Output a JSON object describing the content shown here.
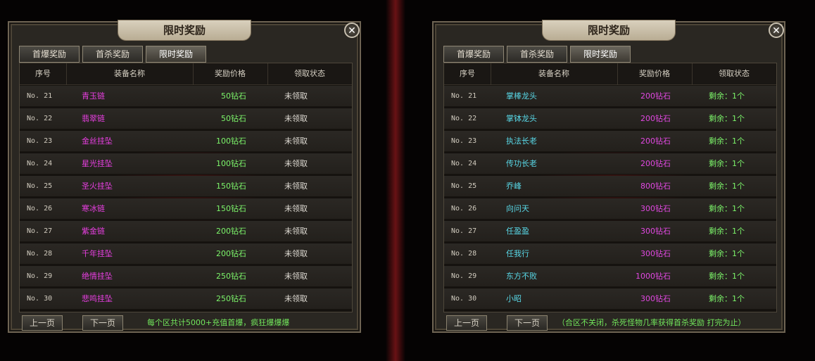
{
  "left_panel": {
    "title": "限时奖励",
    "tabs": [
      "首爆奖励",
      "首杀奖励",
      "限时奖励"
    ],
    "active_tab": 2,
    "columns": [
      "序号",
      "装备名称",
      "奖励价格",
      "领取状态"
    ],
    "rows": [
      {
        "no": "No. 21",
        "name": "青玉链",
        "price": "50钻石",
        "status": "未领取"
      },
      {
        "no": "No. 22",
        "name": "翡翠链",
        "price": "50钻石",
        "status": "未领取"
      },
      {
        "no": "No. 23",
        "name": "金丝挂坠",
        "price": "100钻石",
        "status": "未领取"
      },
      {
        "no": "No. 24",
        "name": "星光挂坠",
        "price": "100钻石",
        "status": "未领取"
      },
      {
        "no": "No. 25",
        "name": "圣火挂坠",
        "price": "150钻石",
        "status": "未领取"
      },
      {
        "no": "No. 26",
        "name": "寒冰链",
        "price": "150钻石",
        "status": "未领取"
      },
      {
        "no": "No. 27",
        "name": "紫金链",
        "price": "200钻石",
        "status": "未领取"
      },
      {
        "no": "No. 28",
        "name": "千年挂坠",
        "price": "200钻石",
        "status": "未领取"
      },
      {
        "no": "No. 29",
        "name": "绝情挂坠",
        "price": "250钻石",
        "status": "未领取"
      },
      {
        "no": "No. 30",
        "name": "悲鸣挂坠",
        "price": "250钻石",
        "status": "未领取"
      }
    ],
    "prev_label": "上一页",
    "next_label": "下一页",
    "note": "每个区共计5000+充值首爆，疯狂爆爆爆"
  },
  "right_panel": {
    "title": "限时奖励",
    "tabs": [
      "首爆奖励",
      "首杀奖励",
      "限时奖励"
    ],
    "active_tab": 2,
    "columns": [
      "序号",
      "装备名称",
      "奖励价格",
      "领取状态"
    ],
    "rows": [
      {
        "no": "No. 21",
        "name": "掌棒龙头",
        "price": "200钻石",
        "status": "剩余：1个"
      },
      {
        "no": "No. 22",
        "name": "掌钵龙头",
        "price": "200钻石",
        "status": "剩余：1个"
      },
      {
        "no": "No. 23",
        "name": "执法长老",
        "price": "200钻石",
        "status": "剩余：1个"
      },
      {
        "no": "No. 24",
        "name": "传功长老",
        "price": "200钻石",
        "status": "剩余：1个"
      },
      {
        "no": "No. 25",
        "name": "乔峰",
        "price": "800钻石",
        "status": "剩余：1个"
      },
      {
        "no": "No. 26",
        "name": "向问天",
        "price": "300钻石",
        "status": "剩余：1个"
      },
      {
        "no": "No. 27",
        "name": "任盈盈",
        "price": "300钻石",
        "status": "剩余：1个"
      },
      {
        "no": "No. 28",
        "name": "任我行",
        "price": "300钻石",
        "status": "剩余：1个"
      },
      {
        "no": "No. 29",
        "name": "东方不败",
        "price": "1000钻石",
        "status": "剩余：1个"
      },
      {
        "no": "No. 30",
        "name": "小昭",
        "price": "300钻石",
        "status": "剩余：1个"
      }
    ],
    "prev_label": "上一页",
    "next_label": "下一页",
    "note": "（合区不关闭，杀死怪物几率获得首杀奖励 打完为止）"
  },
  "icons": {
    "close": "close-icon"
  },
  "colors": {
    "left_name": "#e73fe0",
    "left_price": "#7cf46a",
    "right_name": "#59d9e8",
    "right_price": "#e248e2",
    "status_green": "#7cf46a"
  }
}
